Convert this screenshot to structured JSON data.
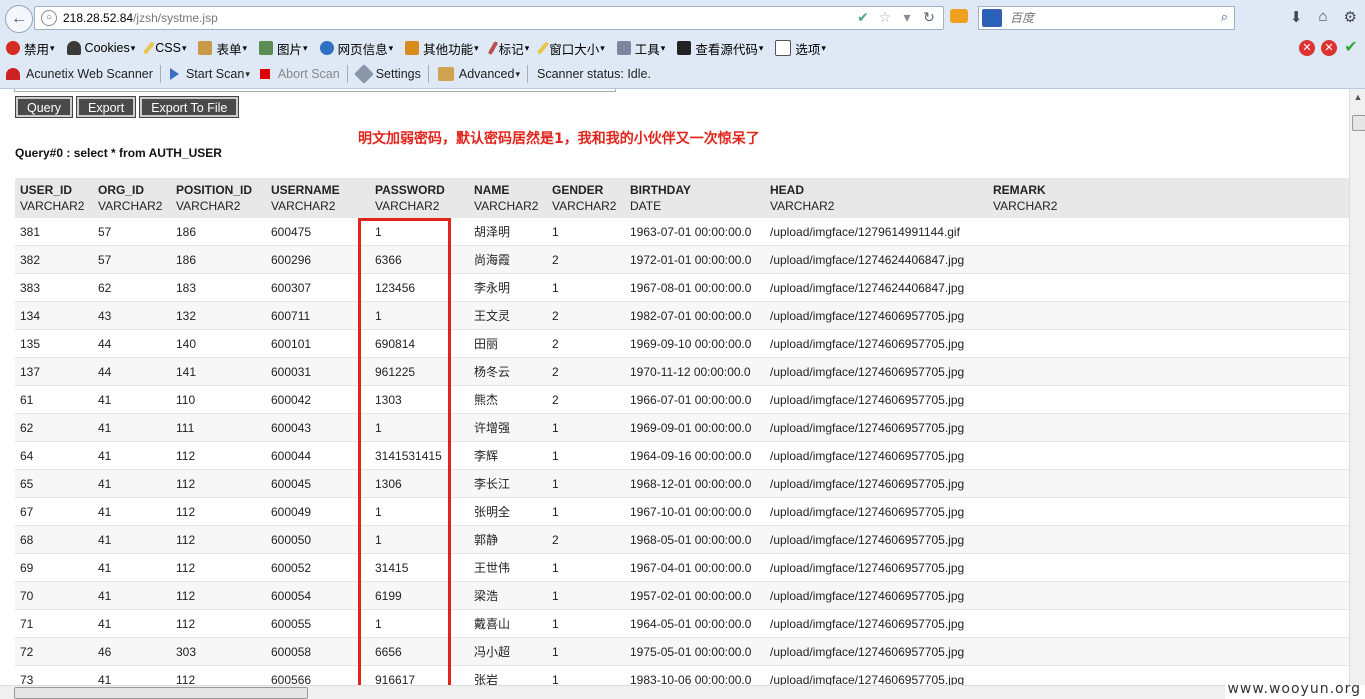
{
  "browser": {
    "url_host": "218.28.52.84",
    "url_path": "/jzsh/systme.jsp",
    "search_placeholder": "百度"
  },
  "menu": {
    "items": [
      {
        "label": "禁用",
        "icon": "disable-icon"
      },
      {
        "label": "Cookies",
        "icon": "cookies-icon"
      },
      {
        "label": "CSS",
        "icon": "css-icon"
      },
      {
        "label": "表单",
        "icon": "form-icon"
      },
      {
        "label": "图片",
        "icon": "image-icon"
      },
      {
        "label": "网页信息",
        "icon": "info-icon"
      },
      {
        "label": "其他功能",
        "icon": "misc-icon"
      },
      {
        "label": "标记",
        "icon": "mark-icon"
      },
      {
        "label": "窗口大小",
        "icon": "window-size-icon"
      },
      {
        "label": "工具",
        "icon": "tools-icon"
      },
      {
        "label": "查看源代码",
        "icon": "source-icon"
      },
      {
        "label": "选项",
        "icon": "options-icon"
      }
    ]
  },
  "scanner": {
    "name": "Acunetix Web Scanner",
    "start": "Start Scan",
    "abort": "Abort Scan",
    "settings": "Settings",
    "advanced": "Advanced",
    "status": "Scanner status: Idle."
  },
  "page": {
    "buttons": {
      "query": "Query",
      "export": "Export",
      "export_file": "Export To File"
    },
    "annotation": "明文加弱密码，默认密码居然是1，我和我的小伙伴又一次惊呆了",
    "query_text": "Query#0 : select * from AUTH_USER",
    "watermark": "www.wooyun.org"
  },
  "table": {
    "columns": [
      {
        "name": "USER_ID",
        "type": "VARCHAR2"
      },
      {
        "name": "ORG_ID",
        "type": "VARCHAR2"
      },
      {
        "name": "POSITION_ID",
        "type": "VARCHAR2"
      },
      {
        "name": "USERNAME",
        "type": "VARCHAR2"
      },
      {
        "name": "PASSWORD",
        "type": "VARCHAR2"
      },
      {
        "name": "NAME",
        "type": "VARCHAR2"
      },
      {
        "name": "GENDER",
        "type": "VARCHAR2"
      },
      {
        "name": "BIRTHDAY",
        "type": "DATE"
      },
      {
        "name": "HEAD",
        "type": "VARCHAR2"
      },
      {
        "name": "REMARK",
        "type": "VARCHAR2"
      }
    ],
    "rows": [
      [
        "381",
        "57",
        "186",
        "600475",
        "1",
        "胡泽明",
        "1",
        "1963-07-01 00:00:00.0",
        "/upload/imgface/1279614991144.gif",
        ""
      ],
      [
        "382",
        "57",
        "186",
        "600296",
        "6366",
        "尚海霞",
        "2",
        "1972-01-01 00:00:00.0",
        "/upload/imgface/1274624406847.jpg",
        ""
      ],
      [
        "383",
        "62",
        "183",
        "600307",
        "123456",
        "李永明",
        "1",
        "1967-08-01 00:00:00.0",
        "/upload/imgface/1274624406847.jpg",
        ""
      ],
      [
        "134",
        "43",
        "132",
        "600711",
        "1",
        "王文灵",
        "2",
        "1982-07-01 00:00:00.0",
        "/upload/imgface/1274606957705.jpg",
        ""
      ],
      [
        "135",
        "44",
        "140",
        "600101",
        "690814",
        "田丽",
        "2",
        "1969-09-10 00:00:00.0",
        "/upload/imgface/1274606957705.jpg",
        ""
      ],
      [
        "137",
        "44",
        "141",
        "600031",
        "961225",
        "杨冬云",
        "2",
        "1970-11-12 00:00:00.0",
        "/upload/imgface/1274606957705.jpg",
        ""
      ],
      [
        "61",
        "41",
        "110",
        "600042",
        "1303",
        "熊杰",
        "2",
        "1966-07-01 00:00:00.0",
        "/upload/imgface/1274606957705.jpg",
        ""
      ],
      [
        "62",
        "41",
        "111",
        "600043",
        "1",
        "许增强",
        "1",
        "1969-09-01 00:00:00.0",
        "/upload/imgface/1274606957705.jpg",
        ""
      ],
      [
        "64",
        "41",
        "112",
        "600044",
        "3141531415",
        "李辉",
        "1",
        "1964-09-16 00:00:00.0",
        "/upload/imgface/1274606957705.jpg",
        ""
      ],
      [
        "65",
        "41",
        "112",
        "600045",
        "1306",
        "李长江",
        "1",
        "1968-12-01 00:00:00.0",
        "/upload/imgface/1274606957705.jpg",
        ""
      ],
      [
        "67",
        "41",
        "112",
        "600049",
        "1",
        "张明全",
        "1",
        "1967-10-01 00:00:00.0",
        "/upload/imgface/1274606957705.jpg",
        ""
      ],
      [
        "68",
        "41",
        "112",
        "600050",
        "1",
        "郭静",
        "2",
        "1968-05-01 00:00:00.0",
        "/upload/imgface/1274606957705.jpg",
        ""
      ],
      [
        "69",
        "41",
        "112",
        "600052",
        "31415",
        "王世伟",
        "1",
        "1967-04-01 00:00:00.0",
        "/upload/imgface/1274606957705.jpg",
        ""
      ],
      [
        "70",
        "41",
        "112",
        "600054",
        "6199",
        "梁浩",
        "1",
        "1957-02-01 00:00:00.0",
        "/upload/imgface/1274606957705.jpg",
        ""
      ],
      [
        "71",
        "41",
        "112",
        "600055",
        "1",
        "戴喜山",
        "1",
        "1964-05-01 00:00:00.0",
        "/upload/imgface/1274606957705.jpg",
        ""
      ],
      [
        "72",
        "46",
        "303",
        "600058",
        "6656",
        "冯小超",
        "1",
        "1975-05-01 00:00:00.0",
        "/upload/imgface/1274606957705.jpg",
        ""
      ],
      [
        "73",
        "41",
        "112",
        "600566",
        "916617",
        "张岩",
        "1",
        "1983-10-06 00:00:00.0",
        "/upload/imgface/1274606957705.jpg",
        ""
      ]
    ]
  },
  "colors": {
    "annotation": "#e0261c",
    "highlight_box": "#e0261c",
    "button_bg": "#4a4a4a"
  }
}
